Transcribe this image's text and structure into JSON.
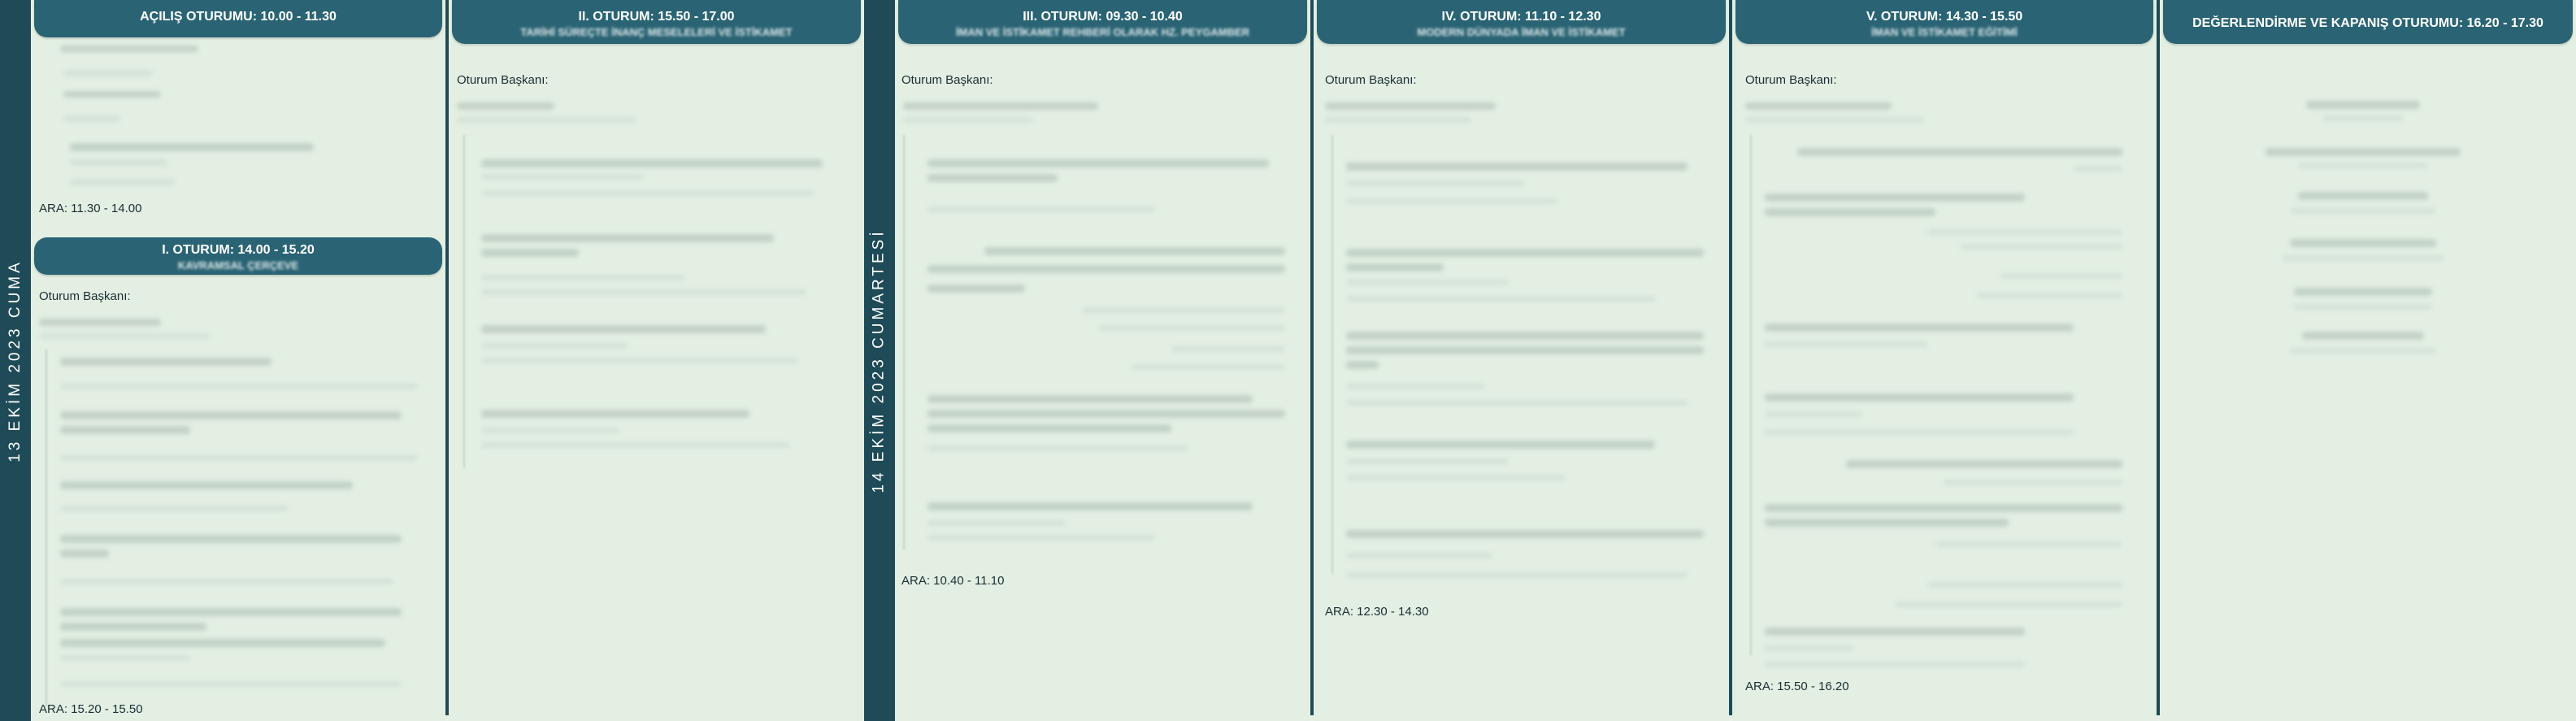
{
  "days": [
    {
      "label": "13 EKİM 2023 CUMA"
    },
    {
      "label": "14 EKİM 2023 CUMARTESİ"
    }
  ],
  "sessions": [
    {
      "title": "AÇILIŞ OTURUMU: 10.00 - 11.30",
      "subtitle": ""
    },
    {
      "title": "I. OTURUM: 14.00 - 15.20",
      "subtitle": "KAVRAMSAL ÇERÇEVE"
    },
    {
      "title": "II. OTURUM: 15.50 - 17.00",
      "subtitle": "TARİHİ SÜREÇTE İNANÇ MESELELERİ VE İSTİKAMET"
    },
    {
      "title": "III. OTURUM: 09.30 - 10.40",
      "subtitle": "İMAN VE İSTİKAMET REHBERİ OLARAK HZ. PEYGAMBER"
    },
    {
      "title": "IV. OTURUM: 11.10 - 12.30",
      "subtitle": "MODERN DÜNYADA İMAN VE İSTİKAMET"
    },
    {
      "title": "V. OTURUM: 14.30 - 15.50",
      "subtitle": "İMAN VE İSTİKAMET EĞİTİMİ"
    },
    {
      "title": "DEĞERLENDİRME VE KAPANIŞ OTURUMU: 16.20 - 17.30",
      "subtitle": ""
    }
  ],
  "chair_label": "Oturum Başkanı:",
  "breaks": [
    "ARA: 11.30 - 14.00",
    "ARA: 15.20 - 15.50",
    "ARA: 10.40 - 11.10",
    "ARA: 12.30 - 14.30",
    "ARA: 15.50 - 16.20"
  ],
  "colors": {
    "band": "#1e4b57",
    "header": "#2a6474",
    "background": "#e3efe3"
  }
}
